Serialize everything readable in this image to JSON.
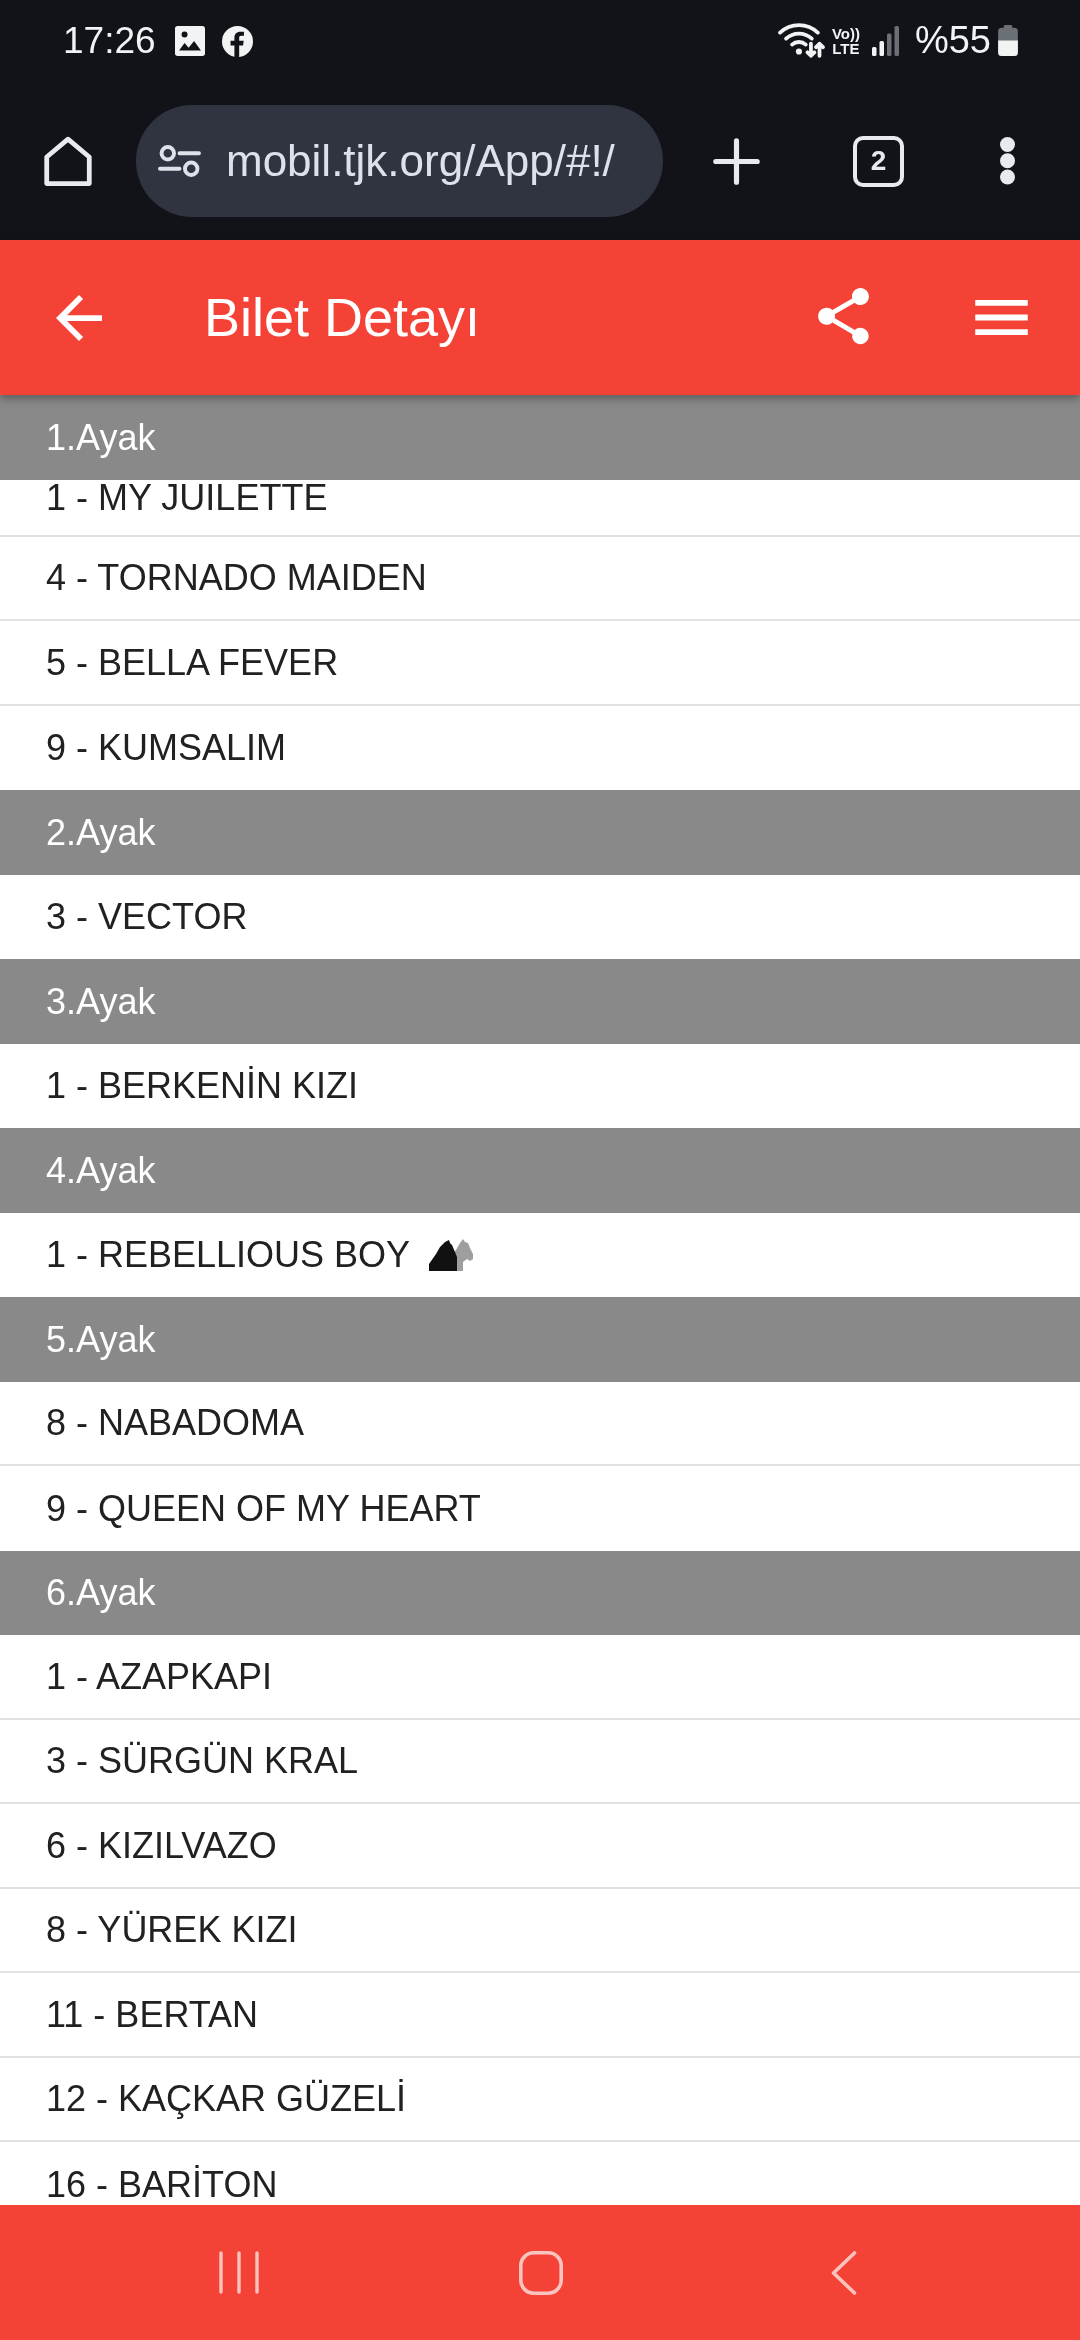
{
  "status_bar": {
    "time": "17:26",
    "network": [
      "Vo))",
      "LTE"
    ],
    "battery": "%55"
  },
  "browser_toolbar": {
    "url": "mobil.tjk.org/App/#!/",
    "tab_count": "2"
  },
  "app_bar": {
    "title": "Bilet Detayı"
  },
  "legs": [
    {
      "title": "1.Ayak",
      "horses": [
        {
          "label": "1 - MY JUILETTE",
          "kind": "plain"
        },
        {
          "label": "4 - TORNADO MAIDEN",
          "kind": "plain"
        },
        {
          "label": "5 - BELLA FEVER",
          "kind": "plain"
        },
        {
          "label": "9 - KUMSALIM",
          "kind": "plain"
        }
      ]
    },
    {
      "title": "2.Ayak",
      "horses": [
        {
          "label": "3 - VECTOR",
          "kind": "plain"
        }
      ]
    },
    {
      "title": "3.Ayak",
      "horses": [
        {
          "label": "1 - BERKENİN KIZI",
          "kind": "plain"
        }
      ]
    },
    {
      "title": "4.Ayak",
      "horses": [
        {
          "label": "1 - REBELLIOUS BOY",
          "kind": "with_icon"
        }
      ]
    },
    {
      "title": "5.Ayak",
      "horses": [
        {
          "label": "8 - NABADOMA",
          "kind": "plain"
        },
        {
          "label": "9 - QUEEN OF MY HEART",
          "kind": "plain"
        }
      ]
    },
    {
      "title": "6.Ayak",
      "horses": [
        {
          "label": "1 - AZAPKAPI",
          "kind": "plain"
        },
        {
          "label": "3 - SÜRGÜN KRAL",
          "kind": "plain"
        },
        {
          "label": "6 - KIZILVAZO",
          "kind": "plain"
        },
        {
          "label": "8 - YÜREK KIZI",
          "kind": "plain"
        },
        {
          "label": "11 - BERTAN",
          "kind": "plain"
        },
        {
          "label": "12 - KAÇKAR GÜZELİ",
          "kind": "plain"
        },
        {
          "label": "16 - BARİTON",
          "kind": "plain"
        }
      ]
    }
  ]
}
